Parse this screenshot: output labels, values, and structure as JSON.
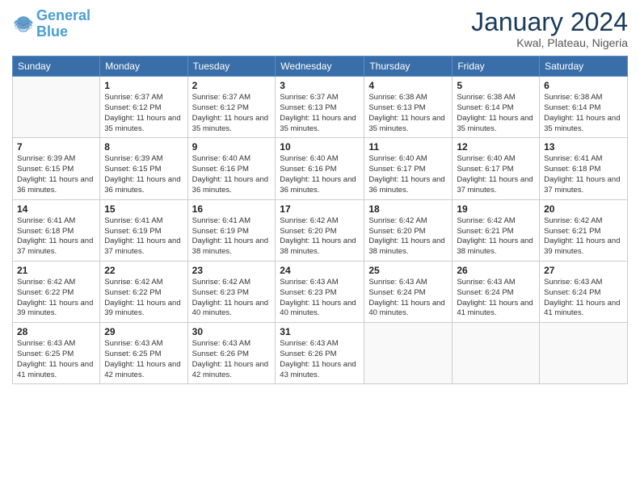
{
  "header": {
    "logo_general": "General",
    "logo_blue": "Blue",
    "month_title": "January 2024",
    "subtitle": "Kwal, Plateau, Nigeria"
  },
  "days_of_week": [
    "Sunday",
    "Monday",
    "Tuesday",
    "Wednesday",
    "Thursday",
    "Friday",
    "Saturday"
  ],
  "weeks": [
    [
      {
        "day": "",
        "sunrise": "",
        "sunset": "",
        "daylight": "",
        "empty": true
      },
      {
        "day": "1",
        "sunrise": "Sunrise: 6:37 AM",
        "sunset": "Sunset: 6:12 PM",
        "daylight": "Daylight: 11 hours and 35 minutes."
      },
      {
        "day": "2",
        "sunrise": "Sunrise: 6:37 AM",
        "sunset": "Sunset: 6:12 PM",
        "daylight": "Daylight: 11 hours and 35 minutes."
      },
      {
        "day": "3",
        "sunrise": "Sunrise: 6:37 AM",
        "sunset": "Sunset: 6:13 PM",
        "daylight": "Daylight: 11 hours and 35 minutes."
      },
      {
        "day": "4",
        "sunrise": "Sunrise: 6:38 AM",
        "sunset": "Sunset: 6:13 PM",
        "daylight": "Daylight: 11 hours and 35 minutes."
      },
      {
        "day": "5",
        "sunrise": "Sunrise: 6:38 AM",
        "sunset": "Sunset: 6:14 PM",
        "daylight": "Daylight: 11 hours and 35 minutes."
      },
      {
        "day": "6",
        "sunrise": "Sunrise: 6:38 AM",
        "sunset": "Sunset: 6:14 PM",
        "daylight": "Daylight: 11 hours and 35 minutes."
      }
    ],
    [
      {
        "day": "7",
        "sunrise": "Sunrise: 6:39 AM",
        "sunset": "Sunset: 6:15 PM",
        "daylight": "Daylight: 11 hours and 36 minutes."
      },
      {
        "day": "8",
        "sunrise": "Sunrise: 6:39 AM",
        "sunset": "Sunset: 6:15 PM",
        "daylight": "Daylight: 11 hours and 36 minutes."
      },
      {
        "day": "9",
        "sunrise": "Sunrise: 6:40 AM",
        "sunset": "Sunset: 6:16 PM",
        "daylight": "Daylight: 11 hours and 36 minutes."
      },
      {
        "day": "10",
        "sunrise": "Sunrise: 6:40 AM",
        "sunset": "Sunset: 6:16 PM",
        "daylight": "Daylight: 11 hours and 36 minutes."
      },
      {
        "day": "11",
        "sunrise": "Sunrise: 6:40 AM",
        "sunset": "Sunset: 6:17 PM",
        "daylight": "Daylight: 11 hours and 36 minutes."
      },
      {
        "day": "12",
        "sunrise": "Sunrise: 6:40 AM",
        "sunset": "Sunset: 6:17 PM",
        "daylight": "Daylight: 11 hours and 37 minutes."
      },
      {
        "day": "13",
        "sunrise": "Sunrise: 6:41 AM",
        "sunset": "Sunset: 6:18 PM",
        "daylight": "Daylight: 11 hours and 37 minutes."
      }
    ],
    [
      {
        "day": "14",
        "sunrise": "Sunrise: 6:41 AM",
        "sunset": "Sunset: 6:18 PM",
        "daylight": "Daylight: 11 hours and 37 minutes."
      },
      {
        "day": "15",
        "sunrise": "Sunrise: 6:41 AM",
        "sunset": "Sunset: 6:19 PM",
        "daylight": "Daylight: 11 hours and 37 minutes."
      },
      {
        "day": "16",
        "sunrise": "Sunrise: 6:41 AM",
        "sunset": "Sunset: 6:19 PM",
        "daylight": "Daylight: 11 hours and 38 minutes."
      },
      {
        "day": "17",
        "sunrise": "Sunrise: 6:42 AM",
        "sunset": "Sunset: 6:20 PM",
        "daylight": "Daylight: 11 hours and 38 minutes."
      },
      {
        "day": "18",
        "sunrise": "Sunrise: 6:42 AM",
        "sunset": "Sunset: 6:20 PM",
        "daylight": "Daylight: 11 hours and 38 minutes."
      },
      {
        "day": "19",
        "sunrise": "Sunrise: 6:42 AM",
        "sunset": "Sunset: 6:21 PM",
        "daylight": "Daylight: 11 hours and 38 minutes."
      },
      {
        "day": "20",
        "sunrise": "Sunrise: 6:42 AM",
        "sunset": "Sunset: 6:21 PM",
        "daylight": "Daylight: 11 hours and 39 minutes."
      }
    ],
    [
      {
        "day": "21",
        "sunrise": "Sunrise: 6:42 AM",
        "sunset": "Sunset: 6:22 PM",
        "daylight": "Daylight: 11 hours and 39 minutes."
      },
      {
        "day": "22",
        "sunrise": "Sunrise: 6:42 AM",
        "sunset": "Sunset: 6:22 PM",
        "daylight": "Daylight: 11 hours and 39 minutes."
      },
      {
        "day": "23",
        "sunrise": "Sunrise: 6:42 AM",
        "sunset": "Sunset: 6:23 PM",
        "daylight": "Daylight: 11 hours and 40 minutes."
      },
      {
        "day": "24",
        "sunrise": "Sunrise: 6:43 AM",
        "sunset": "Sunset: 6:23 PM",
        "daylight": "Daylight: 11 hours and 40 minutes."
      },
      {
        "day": "25",
        "sunrise": "Sunrise: 6:43 AM",
        "sunset": "Sunset: 6:24 PM",
        "daylight": "Daylight: 11 hours and 40 minutes."
      },
      {
        "day": "26",
        "sunrise": "Sunrise: 6:43 AM",
        "sunset": "Sunset: 6:24 PM",
        "daylight": "Daylight: 11 hours and 41 minutes."
      },
      {
        "day": "27",
        "sunrise": "Sunrise: 6:43 AM",
        "sunset": "Sunset: 6:24 PM",
        "daylight": "Daylight: 11 hours and 41 minutes."
      }
    ],
    [
      {
        "day": "28",
        "sunrise": "Sunrise: 6:43 AM",
        "sunset": "Sunset: 6:25 PM",
        "daylight": "Daylight: 11 hours and 41 minutes."
      },
      {
        "day": "29",
        "sunrise": "Sunrise: 6:43 AM",
        "sunset": "Sunset: 6:25 PM",
        "daylight": "Daylight: 11 hours and 42 minutes."
      },
      {
        "day": "30",
        "sunrise": "Sunrise: 6:43 AM",
        "sunset": "Sunset: 6:26 PM",
        "daylight": "Daylight: 11 hours and 42 minutes."
      },
      {
        "day": "31",
        "sunrise": "Sunrise: 6:43 AM",
        "sunset": "Sunset: 6:26 PM",
        "daylight": "Daylight: 11 hours and 43 minutes."
      },
      {
        "day": "",
        "sunrise": "",
        "sunset": "",
        "daylight": "",
        "empty": true
      },
      {
        "day": "",
        "sunrise": "",
        "sunset": "",
        "daylight": "",
        "empty": true
      },
      {
        "day": "",
        "sunrise": "",
        "sunset": "",
        "daylight": "",
        "empty": true
      }
    ]
  ]
}
